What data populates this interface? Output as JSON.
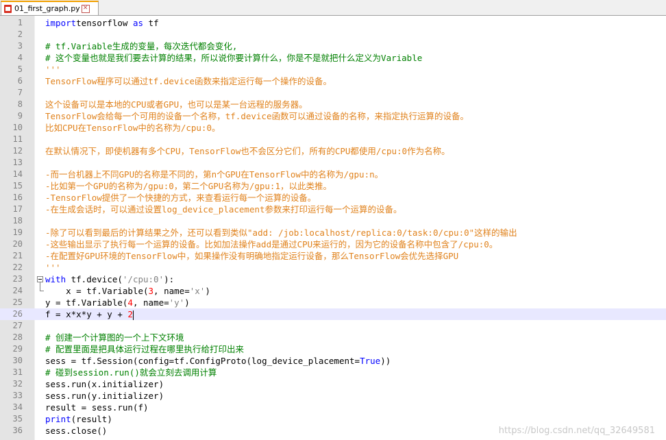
{
  "tab": {
    "label": "01_first_graph.py",
    "close": "✕"
  },
  "lines": [
    {
      "n": "1",
      "segs": [
        [
          "kw",
          "import"
        ],
        [
          "",
          "tensorflow "
        ],
        [
          "kw",
          "as"
        ],
        [
          "",
          " tf"
        ]
      ]
    },
    {
      "n": "2",
      "segs": []
    },
    {
      "n": "3",
      "segs": [
        [
          "cm",
          "# tf.Variable生成的变量，每次迭代都会变化,"
        ]
      ]
    },
    {
      "n": "4",
      "segs": [
        [
          "cm",
          "# 这个变量也就是我们要去计算的结果，所以说你要计算什么，你是不是就把什么定义为Variable"
        ]
      ]
    },
    {
      "n": "5",
      "segs": [
        [
          "ds",
          "'''"
        ]
      ]
    },
    {
      "n": "6",
      "segs": [
        [
          "ds",
          "TensorFlow程序可以通过tf.device函数来指定运行每一个操作的设备。"
        ]
      ]
    },
    {
      "n": "7",
      "segs": []
    },
    {
      "n": "8",
      "segs": [
        [
          "ds",
          "这个设备可以是本地的CPU或者GPU，也可以是某一台远程的服务器。"
        ]
      ]
    },
    {
      "n": "9",
      "segs": [
        [
          "ds",
          "TensorFlow会给每一个可用的设备一个名称，tf.device函数可以通过设备的名称，来指定执行运算的设备。"
        ]
      ]
    },
    {
      "n": "10",
      "segs": [
        [
          "ds",
          "比如CPU在TensorFlow中的名称为/cpu:0。"
        ]
      ]
    },
    {
      "n": "11",
      "segs": []
    },
    {
      "n": "12",
      "segs": [
        [
          "ds",
          "在默认情况下，即使机器有多个CPU，TensorFlow也不会区分它们，所有的CPU都使用/cpu:0作为名称。"
        ]
      ]
    },
    {
      "n": "13",
      "segs": []
    },
    {
      "n": "14",
      "segs": [
        [
          "ds",
          "-而一台机器上不同GPU的名称是不同的，第n个GPU在TensorFlow中的名称为/gpu:n。"
        ]
      ]
    },
    {
      "n": "15",
      "segs": [
        [
          "ds",
          "-比如第一个GPU的名称为/gpu:0，第二个GPU名称为/gpu:1，以此类推。"
        ]
      ]
    },
    {
      "n": "16",
      "segs": [
        [
          "ds",
          "-TensorFlow提供了一个快捷的方式，来查看运行每一个运算的设备。"
        ]
      ]
    },
    {
      "n": "17",
      "segs": [
        [
          "ds",
          "-在生成会话时，可以通过设置log_device_placement参数来打印运行每一个运算的设备。"
        ]
      ]
    },
    {
      "n": "18",
      "segs": []
    },
    {
      "n": "19",
      "segs": [
        [
          "ds",
          "-除了可以看到最后的计算结果之外，还可以看到类似\"add: /job:localhost/replica:0/task:0/cpu:0\"这样的输出"
        ]
      ]
    },
    {
      "n": "20",
      "segs": [
        [
          "ds",
          "-这些输出显示了执行每一个运算的设备。比如加法操作add是通过CPU来运行的，因为它的设备名称中包含了/cpu:0。"
        ]
      ]
    },
    {
      "n": "21",
      "segs": [
        [
          "ds",
          "-在配置好GPU环境的TensorFlow中，如果操作没有明确地指定运行设备，那么TensorFlow会优先选择GPU"
        ]
      ]
    },
    {
      "n": "22",
      "segs": [
        [
          "ds",
          "'''"
        ]
      ]
    },
    {
      "n": "23",
      "segs": [
        [
          "kw",
          "with"
        ],
        [
          "",
          " tf.device("
        ],
        [
          "str",
          "'/cpu:0'"
        ],
        [
          "",
          "):"
        ]
      ]
    },
    {
      "n": "24",
      "segs": [
        [
          "",
          "    x = tf.Variable("
        ],
        [
          "num",
          "3"
        ],
        [
          "",
          ", name="
        ],
        [
          "str",
          "'x'"
        ],
        [
          "",
          ")"
        ]
      ]
    },
    {
      "n": "25",
      "segs": [
        [
          "",
          "y = tf.Variable("
        ],
        [
          "num",
          "4"
        ],
        [
          "",
          ", name="
        ],
        [
          "str",
          "'y'"
        ],
        [
          "",
          ")"
        ]
      ]
    },
    {
      "n": "26",
      "segs": [
        [
          "",
          "f = x*x*y + y + "
        ],
        [
          "num",
          "2"
        ]
      ]
    },
    {
      "n": "27",
      "segs": []
    },
    {
      "n": "28",
      "segs": [
        [
          "cm",
          "# 创建一个计算图的一个上下文环境"
        ]
      ]
    },
    {
      "n": "29",
      "segs": [
        [
          "cm",
          "# 配置里面是把具体运行过程在哪里执行给打印出来"
        ]
      ]
    },
    {
      "n": "30",
      "segs": [
        [
          "",
          "sess = tf.Session(config=tf.ConfigProto(log_device_placement="
        ],
        [
          "kw",
          "True"
        ],
        [
          "",
          "))"
        ]
      ]
    },
    {
      "n": "31",
      "segs": [
        [
          "cm",
          "# 碰到session.run()就会立刻去调用计算"
        ]
      ]
    },
    {
      "n": "32",
      "segs": [
        [
          "",
          "sess.run(x.initializer)"
        ]
      ]
    },
    {
      "n": "33",
      "segs": [
        [
          "",
          "sess.run(y.initializer)"
        ]
      ]
    },
    {
      "n": "34",
      "segs": [
        [
          "",
          "result = sess.run(f)"
        ]
      ]
    },
    {
      "n": "35",
      "segs": [
        [
          "kw",
          "print"
        ],
        [
          "",
          "(result)"
        ]
      ]
    },
    {
      "n": "36",
      "segs": [
        [
          "",
          "sess.close()"
        ]
      ]
    }
  ],
  "current_line": "26",
  "watermark": "https://blog.csdn.net/qq_32649581"
}
